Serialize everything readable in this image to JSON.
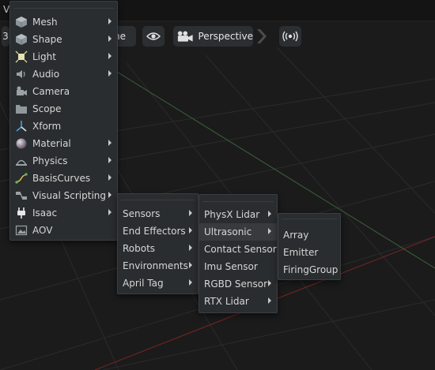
{
  "menubar": {
    "title": "V"
  },
  "toolbar": {
    "left_label": "3",
    "hidden_label_fragment": "ne",
    "camera_label": "Perspective"
  },
  "create_menu": {
    "items": [
      {
        "label": "Mesh",
        "icon": "cube-icon",
        "submenu": true
      },
      {
        "label": "Shape",
        "icon": "cube-icon",
        "submenu": true
      },
      {
        "label": "Light",
        "icon": "light-icon",
        "submenu": true
      },
      {
        "label": "Audio",
        "icon": "speaker-icon",
        "submenu": true
      },
      {
        "label": "Camera",
        "icon": "camera-icon",
        "submenu": false
      },
      {
        "label": "Scope",
        "icon": "folder-icon",
        "submenu": false
      },
      {
        "label": "Xform",
        "icon": "axes-icon",
        "submenu": false
      },
      {
        "label": "Material",
        "icon": "sphere-icon",
        "submenu": true
      },
      {
        "label": "Physics",
        "icon": "physics-icon",
        "submenu": true
      },
      {
        "label": "BasisCurves",
        "icon": "curve-icon",
        "submenu": true
      },
      {
        "label": "Visual Scripting",
        "icon": "graph-icon",
        "submenu": true
      },
      {
        "label": "Isaac",
        "icon": "plug-icon",
        "submenu": true
      },
      {
        "label": "AOV",
        "icon": "image-icon",
        "submenu": false
      }
    ]
  },
  "isaac_menu": {
    "items": [
      {
        "label": "Sensors",
        "submenu": true
      },
      {
        "label": "End Effectors",
        "submenu": true
      },
      {
        "label": "Robots",
        "submenu": true
      },
      {
        "label": "Environments",
        "submenu": true
      },
      {
        "label": "April Tag",
        "submenu": true
      }
    ]
  },
  "sensors_menu": {
    "items": [
      {
        "label": "PhysX Lidar",
        "submenu": true
      },
      {
        "label": "Ultrasonic",
        "submenu": true
      },
      {
        "label": "Contact Sensor",
        "submenu": false
      },
      {
        "label": "Imu Sensor",
        "submenu": false
      },
      {
        "label": "RGBD Sensor",
        "submenu": true
      },
      {
        "label": "RTX Lidar",
        "submenu": true
      }
    ]
  },
  "ultrasonic_menu": {
    "items": [
      {
        "label": "Array"
      },
      {
        "label": "Emitter"
      },
      {
        "label": "FiringGroup"
      }
    ]
  },
  "colors": {
    "background": "#1a1a1a",
    "menu_bg": "#2a2d2f",
    "highlight": "#383b3d",
    "grid_red": "#8a2a2a",
    "grid_green": "#3f6a3f"
  }
}
